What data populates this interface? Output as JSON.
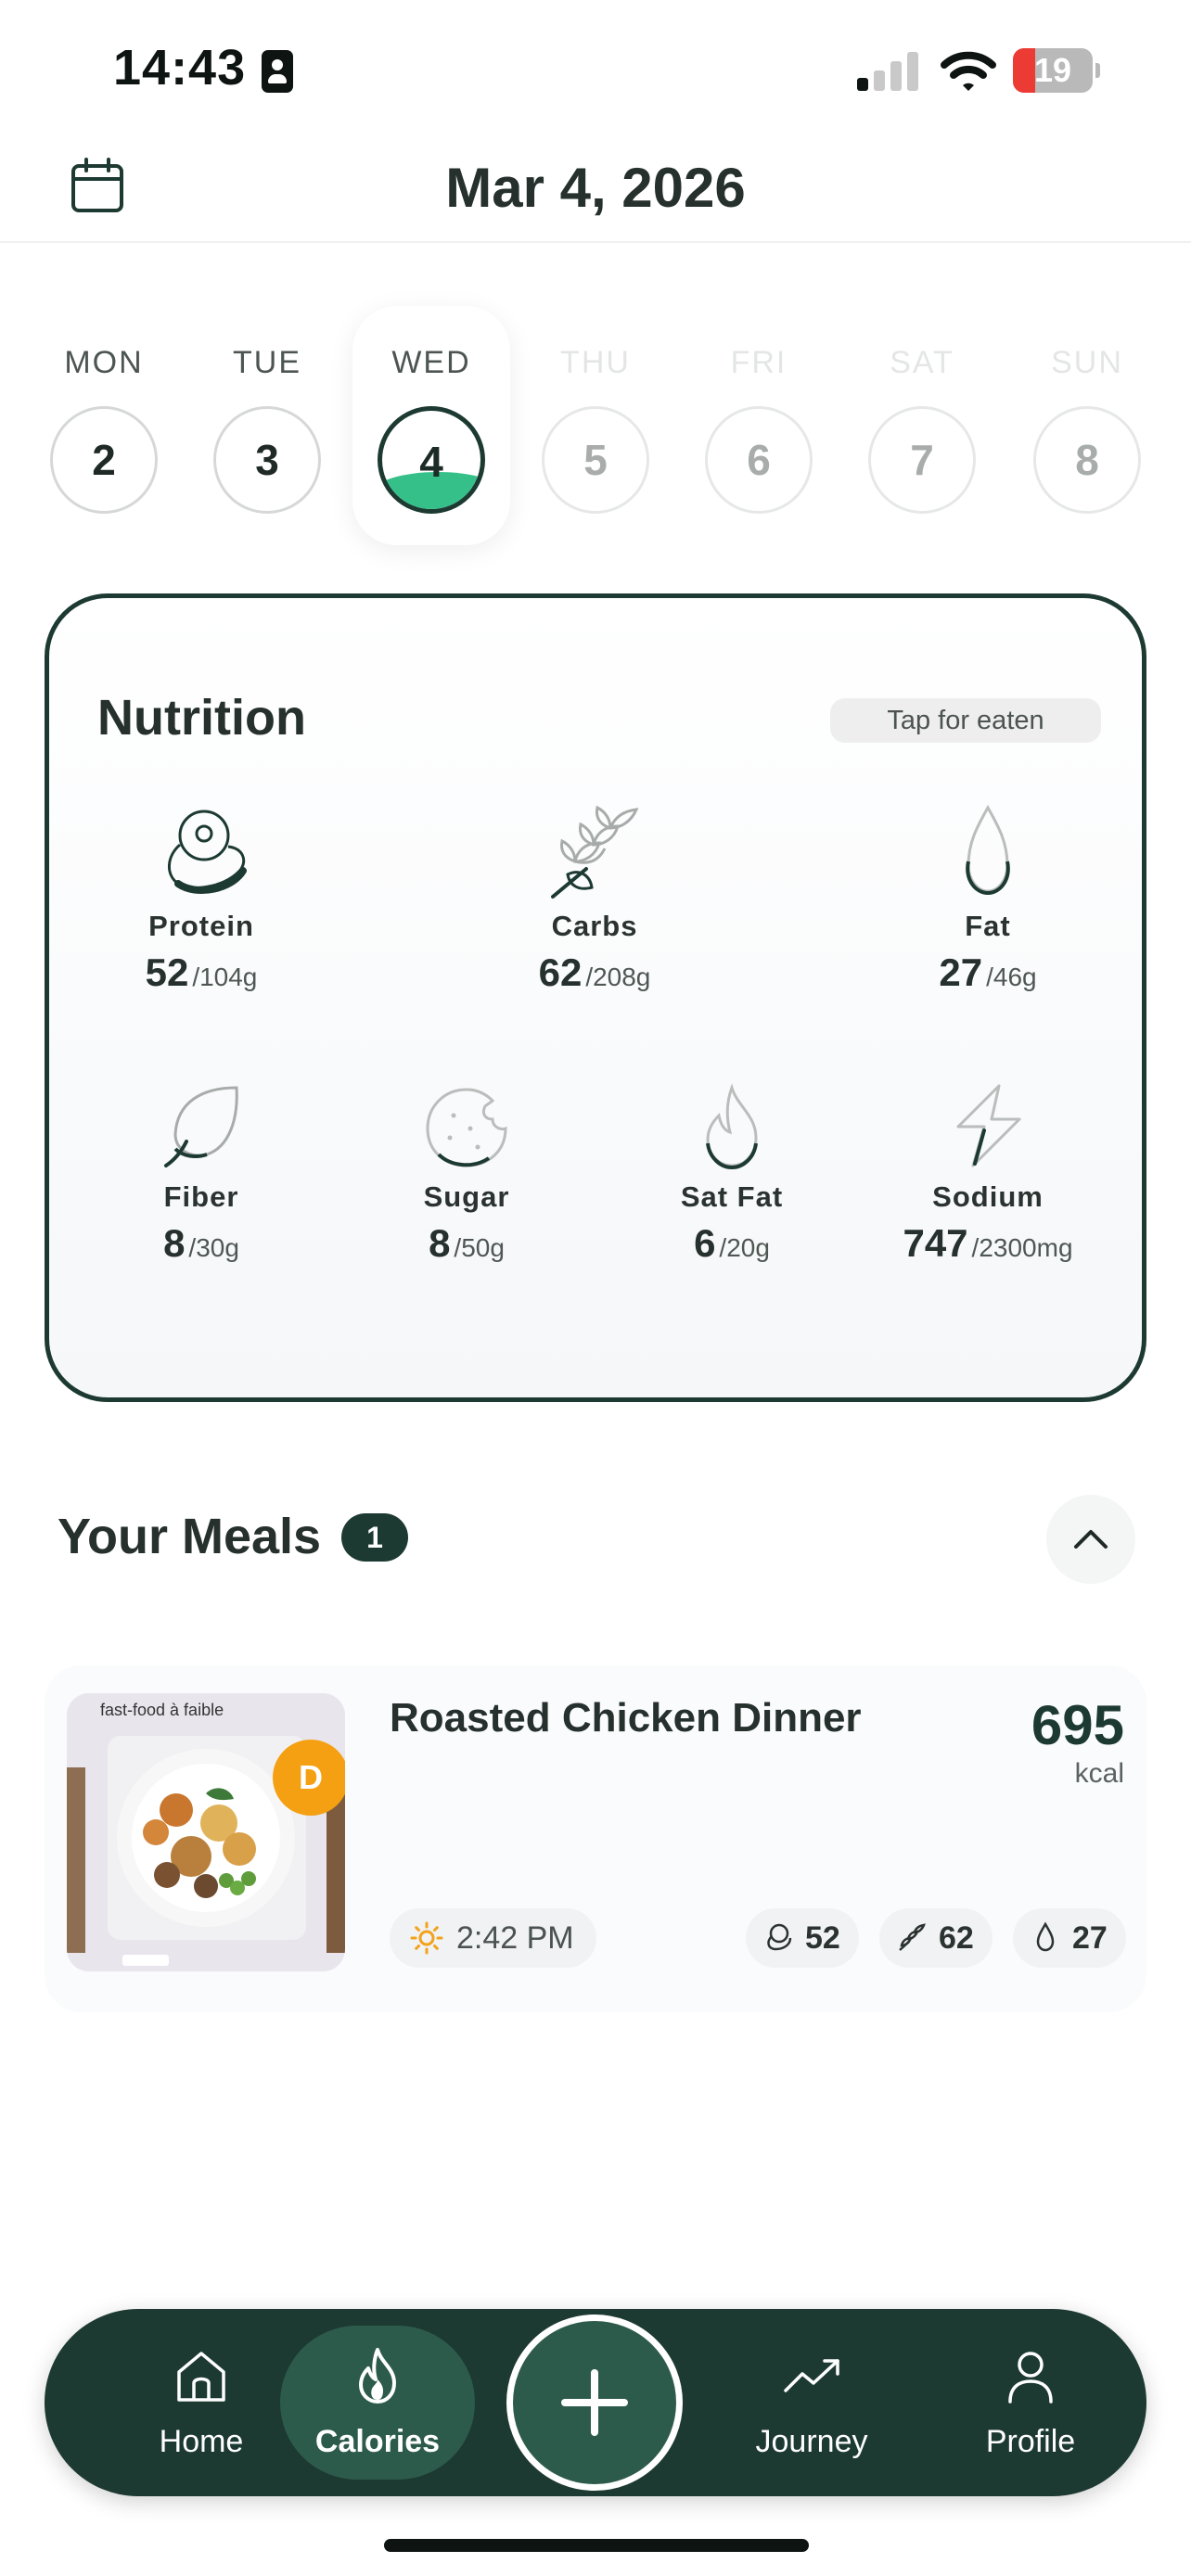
{
  "status_bar": {
    "time": "14:43",
    "battery": "19"
  },
  "header": {
    "date": "Mar 4, 2026"
  },
  "week": {
    "days": [
      {
        "name": "MON",
        "number": "2"
      },
      {
        "name": "TUE",
        "number": "3"
      },
      {
        "name": "WED",
        "number": "4"
      },
      {
        "name": "THU",
        "number": "5"
      },
      {
        "name": "FRI",
        "number": "6"
      },
      {
        "name": "SAT",
        "number": "7"
      },
      {
        "name": "SUN",
        "number": "8"
      }
    ],
    "selected_fill_fraction": 0.4
  },
  "nutrition": {
    "title": "Nutrition",
    "tap_label": "Tap for eaten",
    "items": [
      {
        "label": "Protein",
        "value": "52",
        "goal": "/104g",
        "icon": "steak-icon"
      },
      {
        "label": "Carbs",
        "value": "62",
        "goal": "/208g",
        "icon": "wheat-icon"
      },
      {
        "label": "Fat",
        "value": "27",
        "goal": "/46g",
        "icon": "drop-icon"
      },
      {
        "label": "Fiber",
        "value": "8",
        "goal": "/30g",
        "icon": "leaf-icon"
      },
      {
        "label": "Sugar",
        "value": "8",
        "goal": "/50g",
        "icon": "cookie-icon"
      },
      {
        "label": "Sat Fat",
        "value": "6",
        "goal": "/20g",
        "icon": "flame-icon"
      },
      {
        "label": "Sodium",
        "value": "747",
        "goal": "/2300mg",
        "icon": "bolt-icon"
      }
    ]
  },
  "meals": {
    "title": "Your Meals",
    "count": "1",
    "items": [
      {
        "name": "Roasted Chicken Dinner",
        "kcal": "695",
        "kcal_unit": "kcal",
        "grade": "D",
        "time": "2:42 PM",
        "protein": "52",
        "carbs": "62",
        "fat": "27"
      }
    ]
  },
  "nav": {
    "home": "Home",
    "calories": "Calories",
    "journey": "Journey",
    "profile": "Profile"
  },
  "colors": {
    "brand": "#1d3a32",
    "accent": "#35c08a",
    "grade": "#f4a012"
  }
}
